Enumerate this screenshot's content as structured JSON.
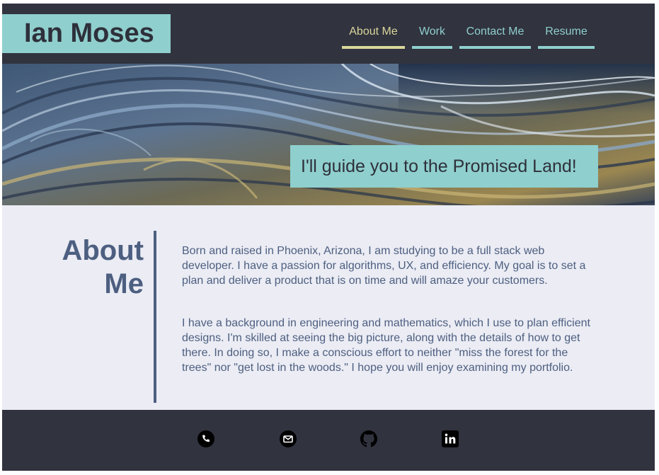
{
  "header": {
    "logo_text": "Ian Moses",
    "nav": [
      {
        "label": "About Me",
        "active": true
      },
      {
        "label": "Work",
        "active": false
      },
      {
        "label": "Contact Me",
        "active": false
      },
      {
        "label": "Resume",
        "active": false
      }
    ]
  },
  "hero": {
    "tagline": "I'll guide you to the Promised Land!"
  },
  "about": {
    "title_line1": "About",
    "title_line2": "Me",
    "paragraphs": [
      "Born and raised in Phoenix, Arizona, I am studying to be a full stack web developer. I have a passion for algorithms, UX, and efficiency. My goal is to set a plan and deliver a product that is on time and will amaze your customers.",
      "I have a background in engineering and mathematics, which I use to plan efficient designs. I'm skilled at seeing the big picture, along with the details of how to get there. In doing so, I make a conscious effort to neither \"miss the forest for the trees\" nor \"get lost in the woods.\" I hope you will enjoy examining my portfolio."
    ]
  },
  "footer": {
    "icons": [
      "phone-icon",
      "email-icon",
      "github-icon",
      "linkedin-icon"
    ]
  },
  "colors": {
    "dark": "#31333f",
    "teal": "#8fcfcd",
    "gold": "#d9d69a",
    "slate": "#4d5f80",
    "background": "#ebecf4"
  }
}
